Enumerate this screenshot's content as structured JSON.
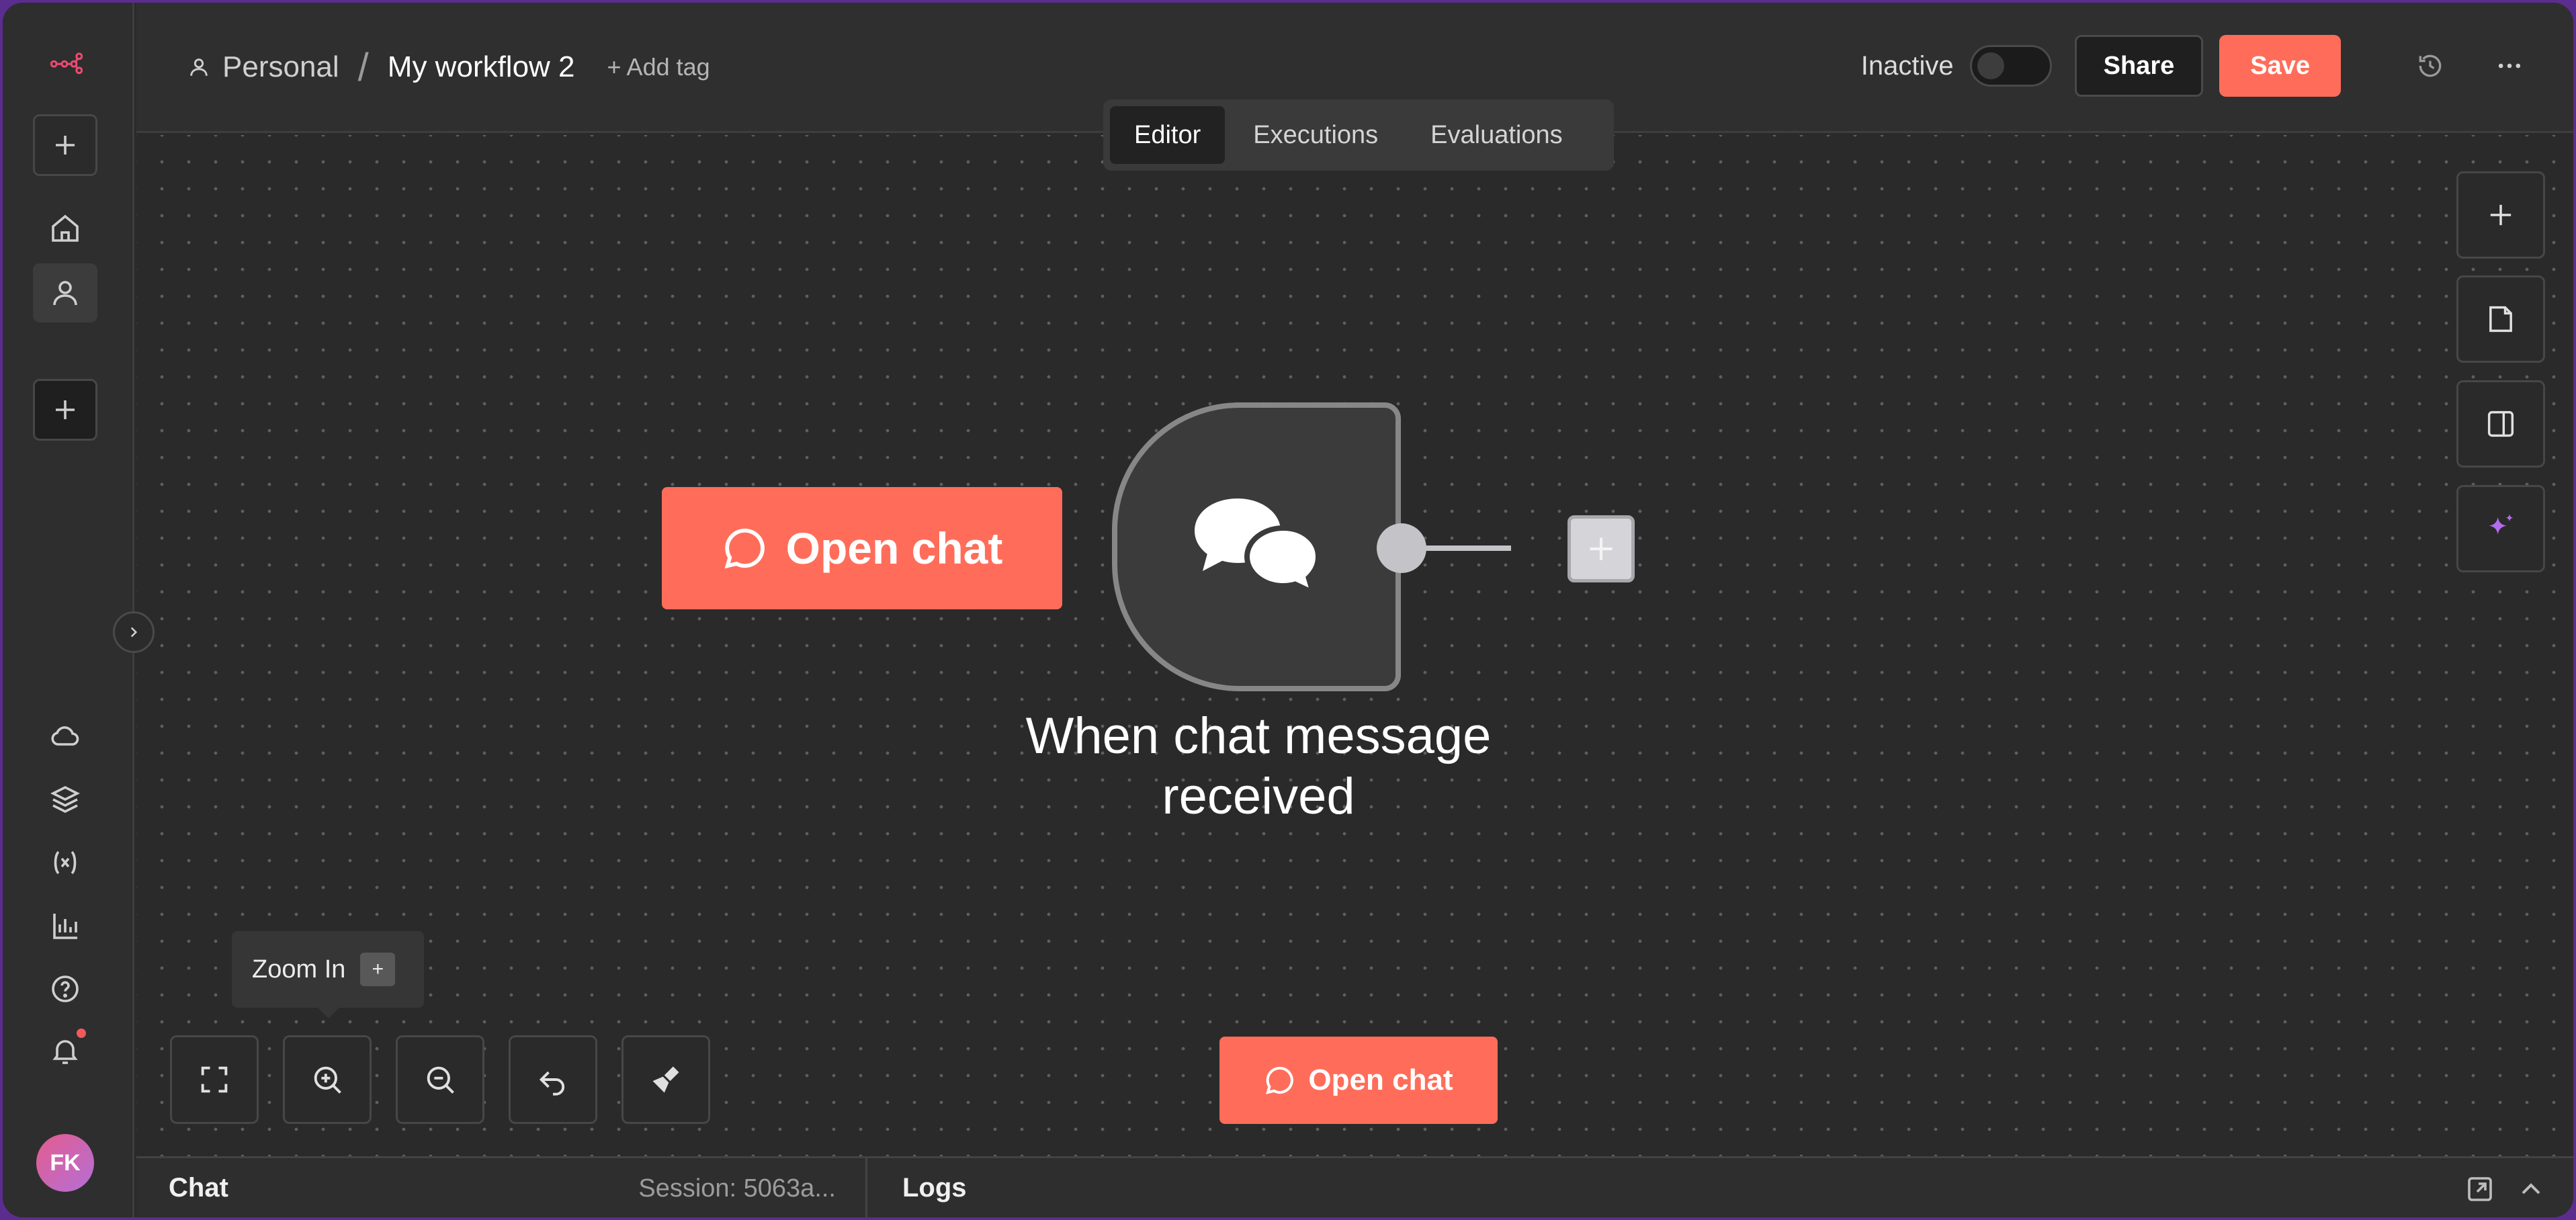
{
  "breadcrumb": {
    "project": "Personal",
    "separator": "/",
    "workflow_name": "My workflow 2",
    "add_tag": "+ Add tag"
  },
  "header": {
    "status": "Inactive",
    "share_label": "Share",
    "save_label": "Save"
  },
  "tabs": [
    {
      "label": "Editor",
      "active": true
    },
    {
      "label": "Executions"
    },
    {
      "label": "Evaluations"
    }
  ],
  "canvas": {
    "open_chat_label": "Open chat",
    "trigger_node": {
      "title": "When chat message received",
      "icon": "chat-bubbles-icon"
    },
    "tooltip": {
      "label": "Zoom In",
      "shortcut": "+"
    },
    "open_chat_bottom_label": "Open chat"
  },
  "user": {
    "initials": "FK"
  },
  "bottom_bar": {
    "chat_label": "Chat",
    "session_label": "Session: 5063a...",
    "logs_label": "Logs"
  },
  "colors": {
    "accent": "#ff6d5a",
    "logo": "#ea4b71",
    "background": "#2a2a2a",
    "ai_sparkle": "#b46bf0"
  }
}
